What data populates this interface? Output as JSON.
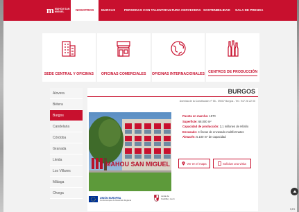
{
  "logo": {
    "mark": "m",
    "text": "Mahou San Miguel"
  },
  "nav": [
    {
      "label": "Nosotros",
      "active": true
    },
    {
      "label": "Marcas",
      "active": false
    },
    {
      "label": "Personas con talento",
      "active": false
    },
    {
      "label": "Cultura cervecera",
      "active": false
    },
    {
      "label": "Sostenibilidad",
      "active": false
    },
    {
      "label": "Sala de prensa",
      "active": false
    }
  ],
  "cards": [
    {
      "label": "SEDE CENTRAL Y OFICINAS",
      "icon": "office-building-icon"
    },
    {
      "label": "OFICINAS COMERCIALES",
      "icon": "storefront-icon"
    },
    {
      "label": "OFICINAS INTERNACIONALES",
      "icon": "globe-icon"
    },
    {
      "label": "CENTROS DE PRODUCCIÓN",
      "icon": "bottles-icon",
      "active": true
    }
  ],
  "cities": [
    "Alovera",
    "Bétera",
    "Burgos",
    "Candelaria",
    "Córdoba",
    "Granada",
    "Lleida",
    "Los Villares",
    "Málaga",
    "Olvega"
  ],
  "active_city": "Burgos",
  "detail": {
    "title": "BURGOS",
    "address": "Avenida de la Constitución nº 55 - 09007 Burgos - Tel.: 947 28 22 00",
    "facts": [
      {
        "label": "Puesta en marcha:",
        "value": "1970"
      },
      {
        "label": "Superficie:",
        "value": "68.000 m²"
      },
      {
        "label": "Capacidad de producción:",
        "value": "2,1 millones de Hl/año"
      },
      {
        "label": "Envasado:",
        "value": "4 líneas de envasado multiformatos"
      },
      {
        "label": "Almacén:",
        "value": "5.100 m² de capacidad"
      }
    ],
    "map_button": "Ver en el mapa",
    "visit_button": "Solicitar una visita",
    "sign_text": "MAHOU SAN MIGUEL"
  },
  "footer_logos": {
    "eu_title": "UNIÓN EUROPEA",
    "eu_sub": "Fondo Europeo de Desarrollo Regional",
    "jcyl": [
      "Junta de",
      "Castilla y León"
    ]
  },
  "zoom": "5,5%",
  "colors": {
    "brand": "#c8102e",
    "background": "#f2f2f2"
  }
}
